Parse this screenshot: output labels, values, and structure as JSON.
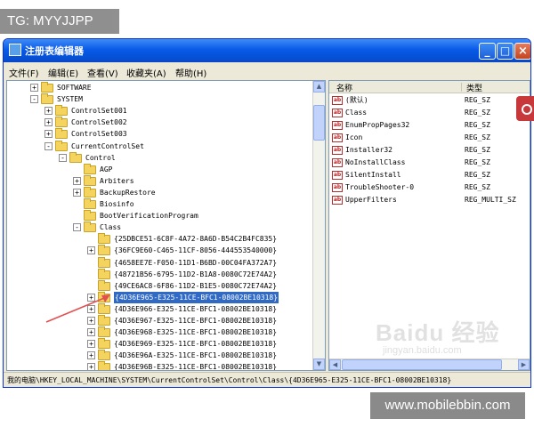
{
  "overlay": {
    "tg_label": "TG: MYYJJPP",
    "site_label": "www.mobilebbin.com",
    "watermark_main": "Baidu 经验",
    "watermark_sub": "jingyan.baidu.com"
  },
  "window": {
    "title": "注册表编辑器",
    "buttons": {
      "minimize": "_",
      "maximize": "□",
      "close": "×"
    }
  },
  "menu": [
    {
      "label": "文件(F)"
    },
    {
      "label": "编辑(E)"
    },
    {
      "label": "查看(V)"
    },
    {
      "label": "收藏夹(A)"
    },
    {
      "label": "帮助(H)"
    }
  ],
  "tree": {
    "items": [
      {
        "label": "SOFTWARE",
        "expander": "+",
        "level": 3
      },
      {
        "label": "SYSTEM",
        "expander": "-",
        "level": 3
      },
      {
        "label": "ControlSet001",
        "expander": "+",
        "level": 4
      },
      {
        "label": "ControlSet002",
        "expander": "+",
        "level": 4
      },
      {
        "label": "ControlSet003",
        "expander": "+",
        "level": 4
      },
      {
        "label": "CurrentControlSet",
        "expander": "-",
        "level": 4
      },
      {
        "label": "Control",
        "expander": "-",
        "level": 5
      },
      {
        "label": "AGP",
        "expander": "",
        "level": 6
      },
      {
        "label": "Arbiters",
        "expander": "+",
        "level": 6
      },
      {
        "label": "BackupRestore",
        "expander": "+",
        "level": 6
      },
      {
        "label": "Biosinfo",
        "expander": "",
        "level": 6
      },
      {
        "label": "BootVerificationProgram",
        "expander": "",
        "level": 6
      },
      {
        "label": "Class",
        "expander": "-",
        "level": 6
      },
      {
        "label": "{25DBCE51-6C8F-4A72-8A6D-B54C2B4FC835}",
        "expander": "",
        "level": 7
      },
      {
        "label": "{36FC9E60-C465-11CF-8056-444553540000}",
        "expander": "+",
        "level": 7
      },
      {
        "label": "{4658EE7E-F050-11D1-B6BD-00C04FA372A7}",
        "expander": "",
        "level": 7
      },
      {
        "label": "{48721B56-6795-11D2-B1A8-0080C72E74A2}",
        "expander": "",
        "level": 7
      },
      {
        "label": "{49CE6AC8-6F86-11D2-B1E5-0080C72E74A2}",
        "expander": "",
        "level": 7
      },
      {
        "label": "{4D36E965-E325-11CE-BFC1-08002BE10318}",
        "expander": "+",
        "level": 7,
        "selected": true
      },
      {
        "label": "{4D36E966-E325-11CE-BFC1-08002BE10318}",
        "expander": "+",
        "level": 7
      },
      {
        "label": "{4D36E967-E325-11CE-BFC1-08002BE10318}",
        "expander": "+",
        "level": 7
      },
      {
        "label": "{4D36E968-E325-11CE-BFC1-08002BE10318}",
        "expander": "+",
        "level": 7
      },
      {
        "label": "{4D36E969-E325-11CE-BFC1-08002BE10318}",
        "expander": "+",
        "level": 7
      },
      {
        "label": "{4D36E96A-E325-11CE-BFC1-08002BE10318}",
        "expander": "+",
        "level": 7
      },
      {
        "label": "{4D36E96B-E325-11CE-BFC1-08002BE10318}",
        "expander": "+",
        "level": 7
      }
    ]
  },
  "list": {
    "columns": {
      "name": "名称",
      "type": "类型"
    },
    "rows": [
      {
        "name": "(默认)",
        "type": "REG_SZ"
      },
      {
        "name": "Class",
        "type": "REG_SZ"
      },
      {
        "name": "EnumPropPages32",
        "type": "REG_SZ"
      },
      {
        "name": "Icon",
        "type": "REG_SZ"
      },
      {
        "name": "Installer32",
        "type": "REG_SZ"
      },
      {
        "name": "NoInstallClass",
        "type": "REG_SZ"
      },
      {
        "name": "SilentInstall",
        "type": "REG_SZ"
      },
      {
        "name": "TroubleShooter-0",
        "type": "REG_SZ"
      },
      {
        "name": "UpperFilters",
        "type": "REG_MULTI_SZ"
      }
    ],
    "value_icon": "ab"
  },
  "statusbar": {
    "path": "我的电脑\\HKEY_LOCAL_MACHINE\\SYSTEM\\CurrentControlSet\\Control\\Class\\{4D36E965-E325-11CE-BFC1-08002BE10318}"
  },
  "colors": {
    "titlebar": "#0a5ae8",
    "selection": "#316ac5",
    "annotation_arrow": "#e05050",
    "side_badge": "#c8373a"
  },
  "icons": {
    "folder": "folder-icon",
    "value": "string-value-icon",
    "app": "regedit-icon"
  }
}
